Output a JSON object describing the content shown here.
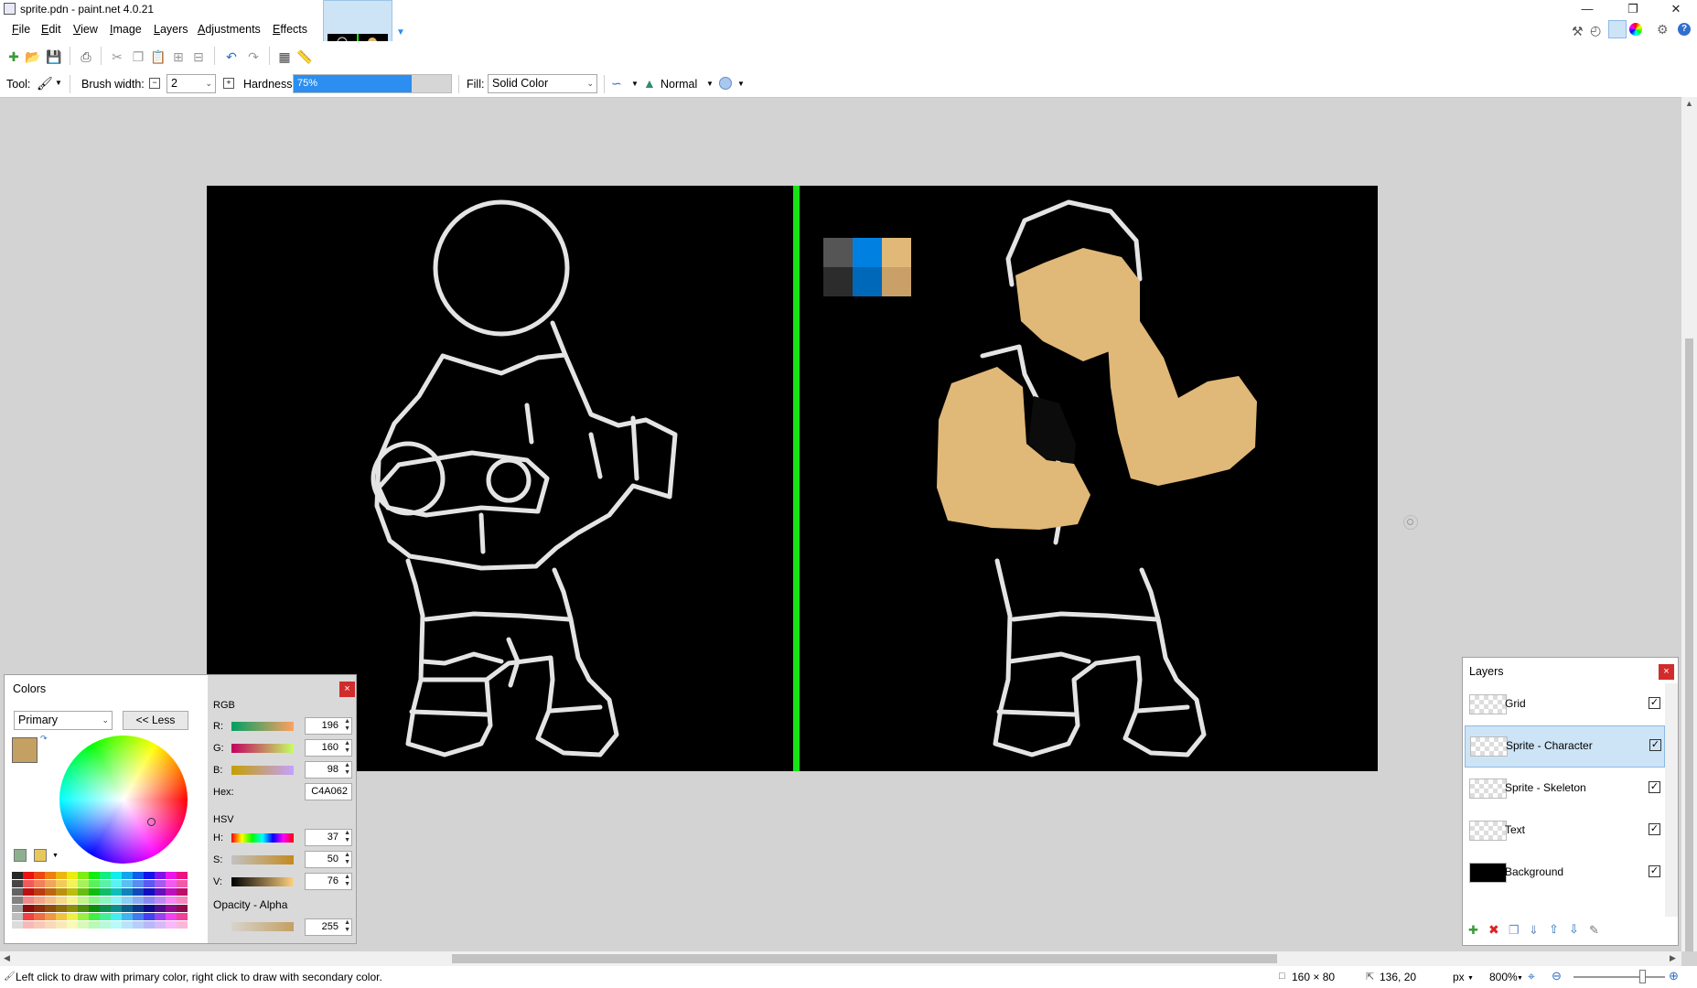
{
  "window": {
    "title": "sprite.pdn - paint.net 4.0.21"
  },
  "menu": [
    "File",
    "Edit",
    "View",
    "Image",
    "Layers",
    "Adjustments",
    "Effects"
  ],
  "toolbar2": {
    "tool_label": "Tool:",
    "brush_width_label": "Brush width:",
    "brush_width_value": "2",
    "hardness_label": "Hardness:",
    "hardness_value": "75%",
    "hardness_fraction": 0.75,
    "fill_label": "Fill:",
    "fill_value": "Solid Color",
    "blend_mode": "Normal"
  },
  "canvas": {
    "swatches": [
      "#555555",
      "#0080e0",
      "#e0b878",
      "#2c2c2c",
      "#0068b8",
      "#c8a068"
    ],
    "divider_color": "#17e317"
  },
  "colors_panel": {
    "title": "Colors",
    "mode": "Primary",
    "less_button": "<< Less",
    "primary_color": "#c4a062",
    "rgb_label": "RGB",
    "r_label": "R:",
    "r_value": "196",
    "g_label": "G:",
    "g_value": "160",
    "b_label": "B:",
    "b_value": "98",
    "hex_label": "Hex:",
    "hex_value": "C4A062",
    "hsv_label": "HSV",
    "h_label": "H:",
    "h_value": "37",
    "s_label": "S:",
    "s_value": "50",
    "v_label": "V:",
    "v_value": "76",
    "opacity_label": "Opacity - Alpha",
    "alpha_value": "255"
  },
  "layers_panel": {
    "title": "Layers",
    "layers": [
      {
        "name": "Grid",
        "visible": true
      },
      {
        "name": "Sprite - Character",
        "visible": true,
        "selected": true
      },
      {
        "name": "Sprite - Skeleton",
        "visible": true
      },
      {
        "name": "Text",
        "visible": true
      },
      {
        "name": "Background",
        "visible": true
      }
    ]
  },
  "status": {
    "hint": "Left click to draw with primary color, right click to draw with secondary color.",
    "image_size": "160 × 80",
    "cursor_pos": "136, 20",
    "unit": "px",
    "zoom": "800%"
  }
}
